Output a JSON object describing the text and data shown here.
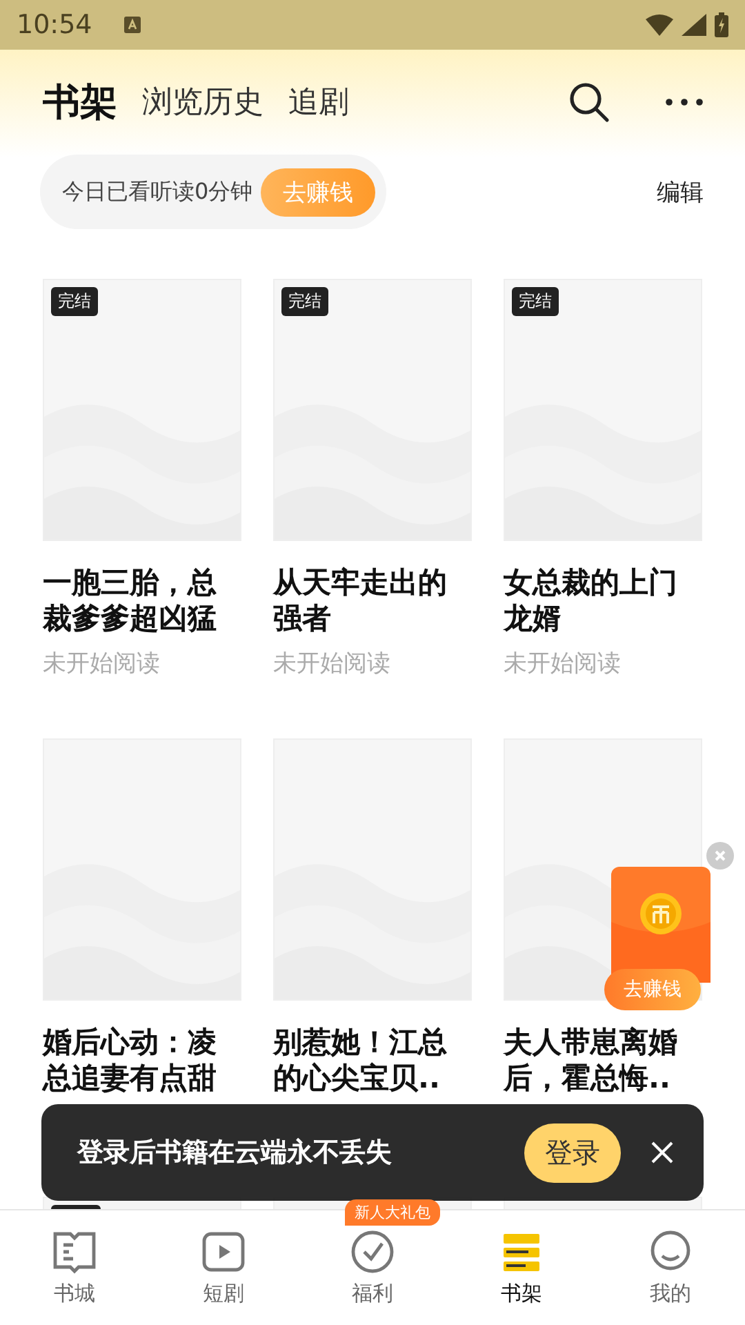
{
  "status_bar": {
    "time": "10:54"
  },
  "tabs": [
    {
      "label": "书架",
      "selected": true
    },
    {
      "label": "浏览历史",
      "selected": false
    },
    {
      "label": "追剧",
      "selected": false
    }
  ],
  "reading_bar": {
    "text": "今日已看听读0分钟",
    "button": "去赚钱",
    "edit": "编辑"
  },
  "books": [
    {
      "title": "一胞三胎，总裁爹爹超凶猛",
      "status": "未开始阅读",
      "badge": "完结"
    },
    {
      "title": "从天牢走出的强者",
      "status": "未开始阅读",
      "badge": "完结"
    },
    {
      "title": "女总裁的上门龙婿",
      "status": "未开始阅读",
      "badge": "完结"
    },
    {
      "title": "婚后心动：凌总追妻有点甜"
    },
    {
      "title": "别惹她！江总的心尖宝贝.."
    },
    {
      "title": "夫人带崽离婚后，霍总悔.."
    }
  ],
  "partial_covers": [
    {
      "finished": true
    },
    {
      "finished": false
    },
    {
      "finished": false
    }
  ],
  "float_widget": {
    "button": "去赚钱"
  },
  "toast": {
    "text": "登录后书籍在云端永不丢失",
    "button": "登录"
  },
  "nav": [
    {
      "label": "书城",
      "kind": "book",
      "selected": false
    },
    {
      "label": "短剧",
      "kind": "play",
      "selected": false
    },
    {
      "label": "福利",
      "kind": "gift",
      "selected": false,
      "badge": "新人大礼包"
    },
    {
      "label": "书架",
      "kind": "shelf",
      "selected": true
    },
    {
      "label": "我的",
      "kind": "user",
      "selected": false
    }
  ]
}
